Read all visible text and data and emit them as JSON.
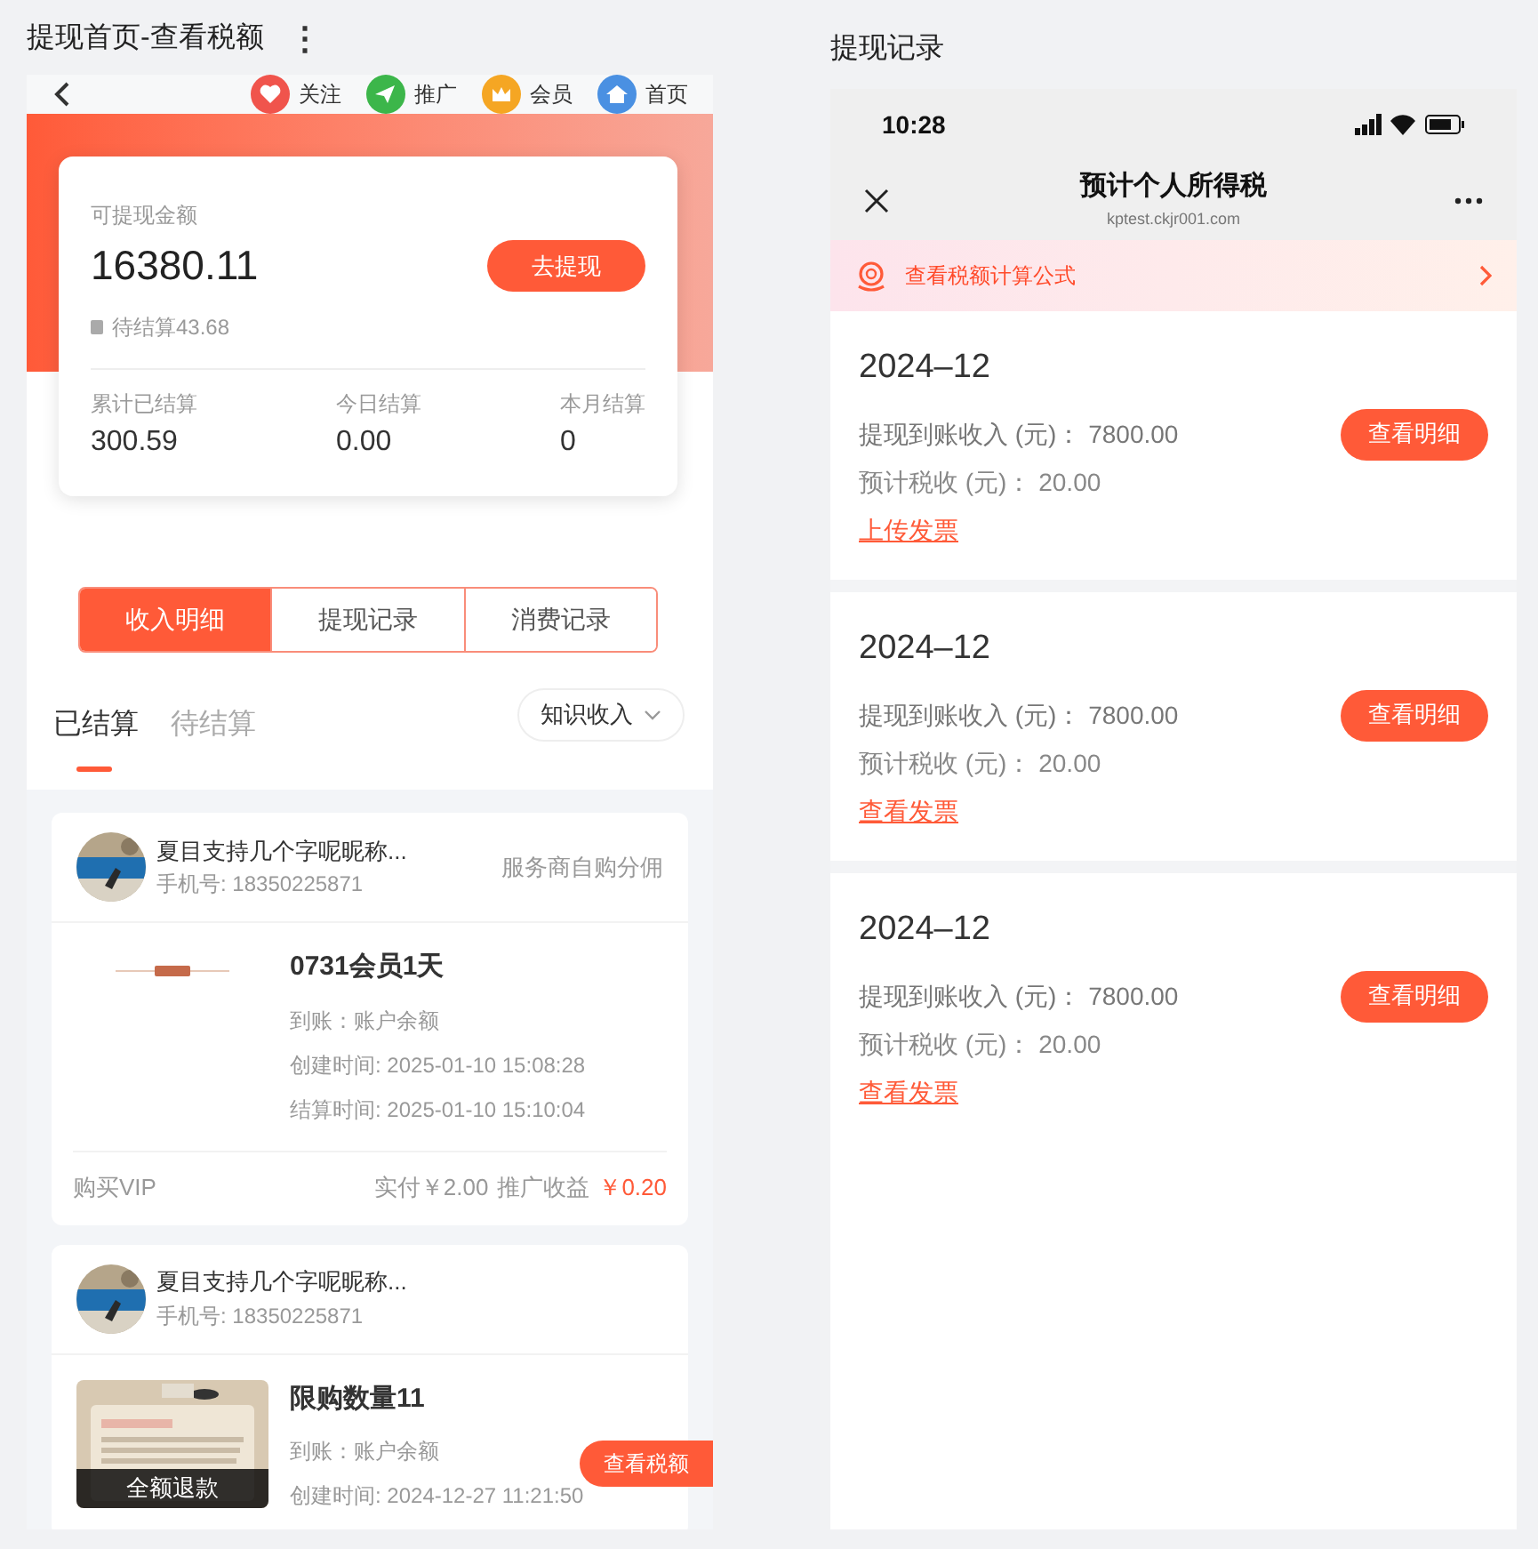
{
  "left_panel": {
    "title": "提现首页-查看税额",
    "menu_icon": "⋮",
    "nav": {
      "items": [
        {
          "kind": "heart",
          "label": "关注"
        },
        {
          "kind": "plane",
          "label": "推广"
        },
        {
          "kind": "crown",
          "label": "会员"
        },
        {
          "kind": "home",
          "label": "首页"
        }
      ]
    },
    "balance_card": {
      "label": "可提现金额",
      "amount": "16380.11",
      "withdraw_button": "去提现",
      "pending": "待结算43.68",
      "stats": [
        {
          "label": "累计已结算",
          "value": "300.59"
        },
        {
          "label": "今日结算",
          "value": "0.00"
        },
        {
          "label": "本月结算",
          "value": "0"
        }
      ]
    },
    "tabs": [
      {
        "label": "收入明细",
        "selected": true
      },
      {
        "label": "提现记录",
        "selected": false
      },
      {
        "label": "消费记录",
        "selected": false
      }
    ],
    "sub_tabs": [
      {
        "label": "已结算",
        "selected": true
      },
      {
        "label": "待结算",
        "selected": false
      }
    ],
    "filter": {
      "value": "知识收入"
    },
    "orders": [
      {
        "nickname": "夏目支持几个字呢昵称...",
        "phone": "手机号: 18350225871",
        "type": "服务商自购分佣",
        "product": "0731会员1天",
        "lines": [
          "到账：账户余额",
          "创建时间: 2025-01-10 15:08:28",
          "结算时间: 2025-01-10 15:10:04"
        ],
        "footer": {
          "left": "购买VIP",
          "paid": "实付￥2.00",
          "income_label": "推广收益",
          "income": "￥0.20"
        }
      },
      {
        "nickname": "夏目支持几个字呢昵称...",
        "phone": "手机号: 18350225871",
        "product": "限购数量11",
        "overlay": "全额退款",
        "lines": [
          "到账：账户余额",
          "创建时间: 2024-12-27 11:21:50"
        ]
      }
    ],
    "float_button": "查看税额"
  },
  "right_panel": {
    "title": "提现记录",
    "status_bar": {
      "time": "10:28"
    },
    "nav": {
      "title": "预计个人所得税",
      "url": "kptest.ckjr001.com"
    },
    "banner": {
      "text": "查看税额计算公式"
    },
    "records": [
      {
        "month": "2024–12",
        "income": "提现到账收入 (元)： 7800.00",
        "tax": "预计税收 (元)： 20.00",
        "link": "上传发票",
        "button": "查看明细"
      },
      {
        "month": "2024–12",
        "income": "提现到账收入 (元)： 7800.00",
        "tax": "预计税收 (元)： 20.00",
        "link": "查看发票",
        "button": "查看明细"
      },
      {
        "month": "2024–12",
        "income": "提现到账收入 (元)： 7800.00",
        "tax": "预计税收 (元)： 20.00",
        "link": "查看发票",
        "button": "查看明细"
      }
    ]
  }
}
